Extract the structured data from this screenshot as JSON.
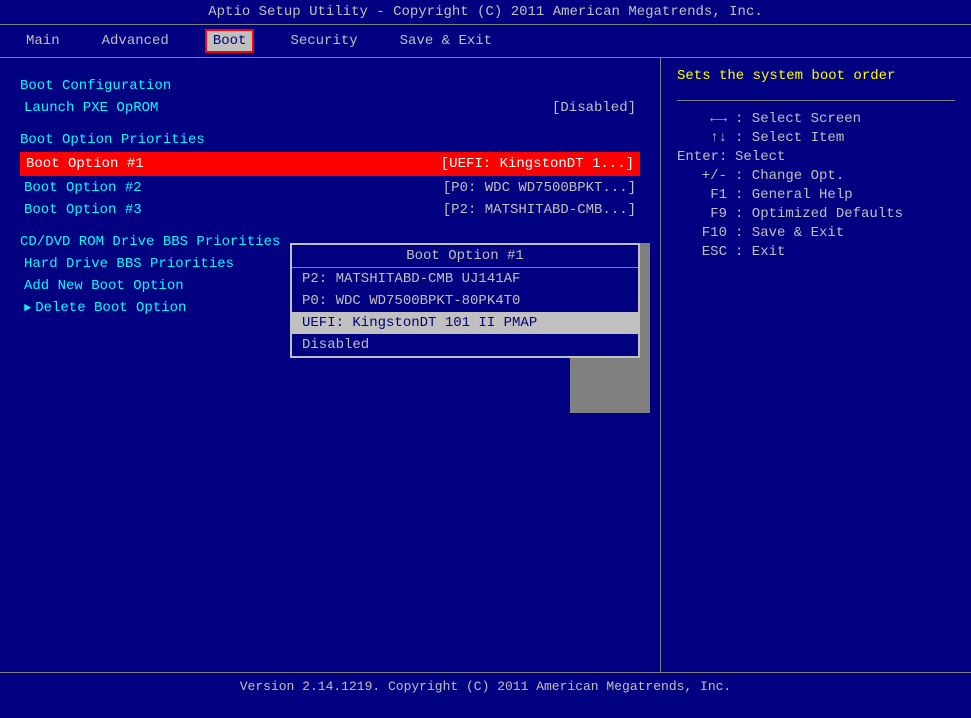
{
  "title": "Aptio Setup Utility - Copyright (C) 2011 American Megatrends, Inc.",
  "menu": {
    "items": [
      {
        "label": "Main",
        "active": false
      },
      {
        "label": "Advanced",
        "active": false
      },
      {
        "label": "Boot",
        "active": true
      },
      {
        "label": "Security",
        "active": false
      },
      {
        "label": "Save & Exit",
        "active": false
      }
    ]
  },
  "left": {
    "section1": "Boot Configuration",
    "launch_pxe_label": "Launch PXE OpROM",
    "launch_pxe_value": "[Disabled]",
    "section2": "Boot Option Priorities",
    "boot_option1_label": "Boot Option #1",
    "boot_option1_value": "[UEFI: KingstonDT 1...]",
    "boot_option2_label": "Boot Option #2",
    "boot_option2_value": "[P0: WDC WD7500BPKT...]",
    "boot_option3_label": "Boot Option #3",
    "boot_option3_value": "[P2: MATSHITABD-CMB...]",
    "section3": "CD/DVD ROM Drive BBS Priorities",
    "hard_drive_label": "Hard Drive BBS Priorities",
    "add_boot_label": "Add New Boot Option",
    "delete_boot_label": "Delete Boot Option"
  },
  "dropdown": {
    "title": "Boot Option #1",
    "options": [
      {
        "label": "P2: MATSHITABD-CMB UJ141AF",
        "selected": false
      },
      {
        "label": "P0: WDC WD7500BPKT-80PK4T0",
        "selected": false
      },
      {
        "label": "UEFI: KingstonDT 101 II PMAP",
        "selected": true
      },
      {
        "label": "Disabled",
        "selected": false
      }
    ]
  },
  "right": {
    "help_text": "Sets the system boot order",
    "keys": [
      {
        "key": "←→",
        "desc": ": Select Screen"
      },
      {
        "key": "↑↓",
        "desc": ": Select Item"
      },
      {
        "key": "Enter:",
        "desc": "Select"
      },
      {
        "key": "+/-",
        "desc": ": Change Opt."
      },
      {
        "key": "F1",
        "desc": ": General Help"
      },
      {
        "key": "F9",
        "desc": ": Optimized Defaults"
      },
      {
        "key": "F10",
        "desc": ": Save & Exit"
      },
      {
        "key": "ESC",
        "desc": ": Exit"
      }
    ]
  },
  "status_bar": "Version 2.14.1219. Copyright (C) 2011 American Megatrends, Inc."
}
